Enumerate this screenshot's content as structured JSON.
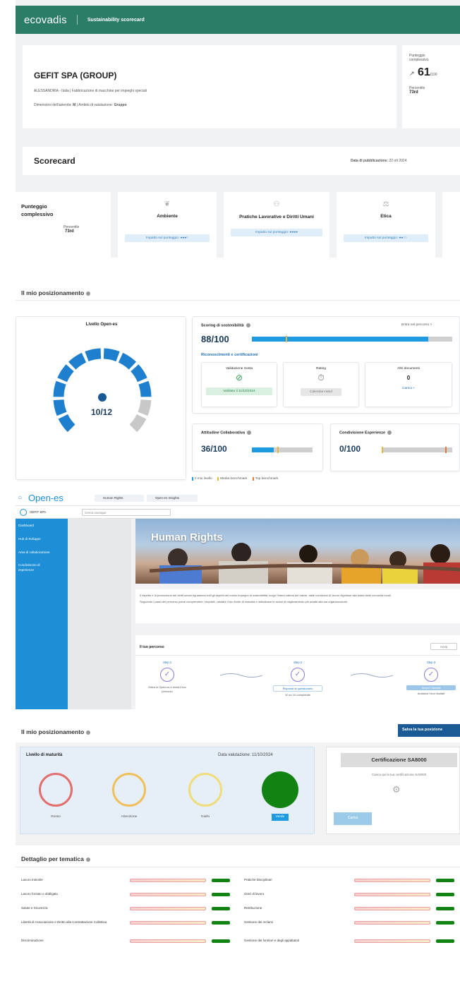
{
  "header": {
    "logo": "ecovadis",
    "title": "Sustainability scorecard"
  },
  "company": {
    "name": "GEFIT SPA (GROUP)",
    "location": "ALESSANDRIA - Italia",
    "industry": "Fabbricazione di macchine per impieghi speciali",
    "size_label": "Dimensioni dell'azienda:",
    "size": "M",
    "scope_label": "Ambito di valutazione:",
    "scope": "Gruppo"
  },
  "overall": {
    "label": "Punteggio complessivo",
    "score": "61",
    "max": "/100",
    "percentile_label": "Percentile",
    "percentile": "73rd"
  },
  "scorecard": {
    "title": "Scorecard",
    "pub_label": "Data di pubblicazione:",
    "pub_date": "22 ott 2024"
  },
  "themes": [
    {
      "label": "Punteggio complessivo",
      "percentile_label": "Percentile",
      "percentile": "73rd"
    },
    {
      "label": "Ambiente",
      "impact": "Impatto sul punteggio: ●●●○",
      "icon": "leaf-icon"
    },
    {
      "label": "Pratiche Lavorative e Diritti Umani",
      "impact": "Impatto sul punteggio: ●●●●",
      "icon": "people-icon"
    },
    {
      "label": "Etica",
      "impact": "Impatto sul punteggio: ●●○○",
      "icon": "scale-icon"
    }
  ],
  "positioning": {
    "title": "Il mio posizionamento",
    "level_title": "Livello Open-es",
    "level": "10/12",
    "sust_label": "Scoring di sostenibilità",
    "sust_link": "Entra nel percorso >",
    "sust_score": "88/100",
    "sust_value": 88,
    "recog_label": "Riconoscimenti e certificazioni",
    "recog": [
      {
        "title": "Validazione Sosta",
        "badge": "Validato il 11/10/2024",
        "icon": "check-circle-icon"
      },
      {
        "title": "Rating",
        "badge": "Calendar-rated",
        "icon": "stopwatch-icon"
      },
      {
        "title": "Altri documenti",
        "value": "0",
        "link": "Carica +"
      }
    ],
    "collab_label": "Attitudine Collaborativa",
    "collab_score": "36/100",
    "collab_value": 36,
    "exp_label": "Condivisione Esperienze",
    "exp_score": "0/100",
    "exp_value": 0,
    "legend": [
      "Il mio livello",
      "Media benchmark",
      "Top benchmark"
    ]
  },
  "openes": {
    "logo": "Open-es",
    "tab1": "Human Rights",
    "tab2": "Open-es Insights",
    "company": "GEFIT SPA",
    "search_placeholder": "Cerca ovunque",
    "sidebar": [
      "Dashboard",
      "Hub di Sviluppo",
      "Area di collaborazione",
      "Condivisione di esperienze"
    ],
    "hero": "Human Rights",
    "para1": "Il rispetto e la promozione dei diritti umani riguardano tutti gli aspetti del nostro impegno di sostenibilità, lungo l'intera catena del valore, dalle condizioni di lavoro dignitose alla tutela delle comunità locali.",
    "para2": "Seguendo i passi del percorso potrai comprendere i requisiti, valutare il tuo livello di maturità e individuare le azioni di miglioramento più adatte alla tua organizzazione.",
    "path_title": "Il tuo percorso",
    "path_btn": "Avvia",
    "steps": [
      {
        "label": "Step 1",
        "text": "Entra in Open-es e inizia il tuo percorso"
      },
      {
        "label": "Step 2",
        "text": "Rispondi al questionario",
        "sub": "10 su 10 completate"
      },
      {
        "label": "Step 3",
        "text": "Scopri i risultati",
        "sub": "Analizza i tuoi risultati"
      }
    ]
  },
  "maturity": {
    "title": "Il mio posizionamento",
    "save_btn": "Salva la tua posizione",
    "level_title": "Livello di maturità",
    "date_label": "Data valutazione:",
    "date": "11/10/2024",
    "levels": [
      "Rosso",
      "Attenzione",
      "Giallo",
      "Verde"
    ],
    "cert_title": "Certificazione SA8000",
    "cert_text": "Carica qui la tua certificazione SA8000",
    "cert_btn": "Carica"
  },
  "detail": {
    "title": "Dettaglio per tematica",
    "left": [
      "Lavoro minorile",
      "Lavoro forzato o obbligato",
      "Salute e Sicurezza",
      "Libertà di Associazione e Diritto alla Contrattazione Collettiva",
      "Discriminazione"
    ],
    "right": [
      "Pratiche Disciplinari",
      "Orari di lavoro",
      "Retribuzione",
      "Gestione dei reclami",
      "Gestione dei fornitori e degli appaltatori"
    ]
  },
  "colors": {
    "brand": "#2b7d67",
    "blue": "#1e8fd6",
    "navy": "#1a5a95",
    "green": "#128212",
    "red": "#e14a4a"
  }
}
